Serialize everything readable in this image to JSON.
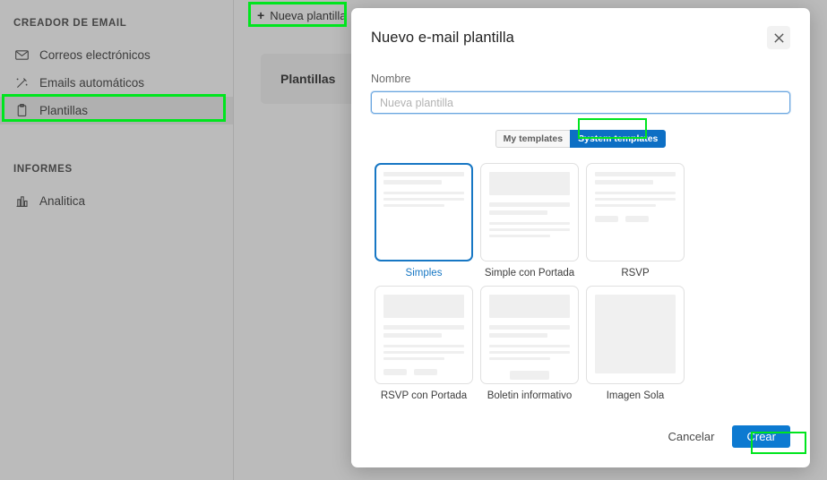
{
  "sidebar": {
    "sections": [
      {
        "title": "CREADOR DE EMAIL",
        "items": [
          {
            "label": "Correos electrónicos",
            "icon": "envelope-icon",
            "active": false
          },
          {
            "label": "Emails automáticos",
            "icon": "magic-wand-icon",
            "active": false
          },
          {
            "label": "Plantillas",
            "icon": "clipboard-icon",
            "active": true
          }
        ]
      },
      {
        "title": "INFORMES",
        "items": [
          {
            "label": "Analitica",
            "icon": "bar-chart-icon",
            "active": false
          }
        ]
      }
    ]
  },
  "content": {
    "new_template_button": "Nueva plantilla",
    "new_template_plus": "+",
    "card_title": "Plantillas"
  },
  "modal": {
    "title": "Nuevo e-mail plantilla",
    "close_icon": "close-icon",
    "name_label": "Nombre",
    "name_value": "",
    "name_placeholder": "Nueva plantilla",
    "segments": [
      {
        "label": "My templates",
        "selected": false
      },
      {
        "label": "System templates",
        "selected": true
      }
    ],
    "templates": [
      {
        "label": "Simples",
        "selected": true,
        "layout": "simple"
      },
      {
        "label": "Simple con Portada",
        "selected": false,
        "layout": "cover"
      },
      {
        "label": "RSVP",
        "selected": false,
        "layout": "rsvp"
      },
      {
        "label": "RSVP con Portada",
        "selected": false,
        "layout": "rsvp-cover"
      },
      {
        "label": "Boletin informativo",
        "selected": false,
        "layout": "newsletter"
      },
      {
        "label": "Imagen Sola",
        "selected": false,
        "layout": "image-only"
      }
    ],
    "cancel_label": "Cancelar",
    "create_label": "Crear"
  },
  "colors": {
    "accent_blue": "#0d7ad1",
    "selected_border": "#1777c4",
    "highlight_green": "#00e51e",
    "segment_active": "#0d6fc4"
  }
}
